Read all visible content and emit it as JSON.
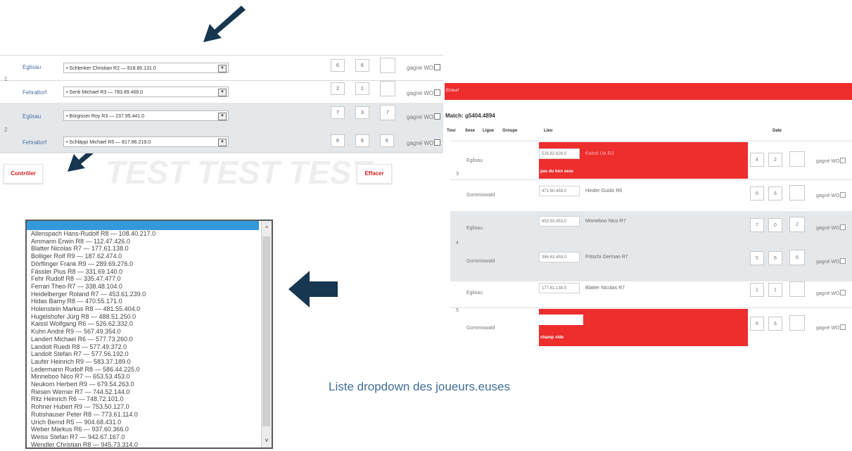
{
  "left_form": {
    "rows": [
      {
        "num": "1",
        "club": "Eglisau",
        "player": "• Schlenker Christian R2 — 818.80.131.0",
        "scores": [
          "6",
          "6",
          ""
        ],
        "wo_label": "gagné WO"
      },
      {
        "num": "",
        "club": "Fehraltorf",
        "player": "• Senti Michael R3 — 783.89.468.0",
        "scores": [
          "2",
          "1",
          ""
        ],
        "wo_label": "gagné WO"
      },
      {
        "num": "2",
        "club": "Eglisau",
        "player": "• Bürgisser Roy R3 — 237.95.441.0",
        "scores": [
          "7",
          "3",
          "7"
        ],
        "wo_label": "gagné WO"
      },
      {
        "num": "",
        "club": "Fehraltorf",
        "player": "• Schläppi Michael R5 — 817.86.219.0",
        "scores": [
          "6",
          "6",
          "6"
        ],
        "wo_label": "gagné WO"
      }
    ],
    "check_button": "Contrôler",
    "clear_button": "Effacer",
    "watermark": "TEST"
  },
  "right_form": {
    "error_banner": "Erreur!",
    "match_label": "Match:",
    "match_id": "g5404.4894",
    "headers": [
      "Tour",
      "Sexe",
      "Ligue",
      "Groupe",
      "Lieu",
      "Date"
    ],
    "rows": [
      {
        "num": "3",
        "club": "Eglisau",
        "license": "526.62.626.0",
        "player": "Kaissl Ua R3",
        "error": "pas du bon sexe",
        "scores": [
          "4",
          "2",
          ""
        ],
        "wo_label": "gagné WO"
      },
      {
        "num": "",
        "club": "Gommiswald",
        "license": "471.60.459.0",
        "player": "Hinder Guido R6",
        "error": "",
        "scores": [
          "6",
          "6",
          ""
        ],
        "wo_label": "gagné WO"
      },
      {
        "num": "4",
        "club": "Eglisau",
        "license": "653.53.453.0",
        "player": "Minneboo Nico R7",
        "error": "",
        "scores": [
          "7",
          "0",
          "2"
        ],
        "wo_label": "gagné WO"
      },
      {
        "num": "",
        "club": "Gommiswald",
        "license": "366.63.459.0",
        "player": "Fritschi German R7",
        "error": "",
        "scores": [
          "5",
          "6",
          "6"
        ],
        "wo_label": "gagné WO"
      },
      {
        "num": "5",
        "club": "Eglisau",
        "license": "177.61.138.0",
        "player": "Blatter Nicolas R7",
        "error": "",
        "scores": [
          "1",
          "1",
          ""
        ],
        "wo_label": "gagné WO"
      },
      {
        "num": "",
        "club": "Gommiswald",
        "license": "",
        "player": "",
        "error": "champ vide",
        "scores": [
          "6",
          "6",
          ""
        ],
        "wo_label": "gagné WO"
      }
    ]
  },
  "dropdown_list": {
    "items": [
      "Allenspach Hans-Rudolf R8 — 108.40.217.0",
      "Ammann Erwin R8 — 112.47.426.0",
      "Blatter Nicolas R7 — 177.61.138.0",
      "Bolliger Rolf R9 — 187.62.474.0",
      "Dörflinger Frank R9 — 289.69.276.0",
      "Fässler Pius R8 — 331.69.140.0",
      "Fehr Rudolf R8 — 335.47.477.0",
      "Ferrari Theo R7 — 338.48.104.0",
      "Heidelberger Roland R7 — 453.61.239.0",
      "Hidas Barny R8 — 470.55.171.0",
      "Holenstein Markus R8 — 481.55.404.0",
      "Hugelshofer Jürg R8 — 488.51.250.0",
      "Kaissl Wolfgang R6 — 526.62.332.0",
      "Kuhn André R9 — 567.49.354.0",
      "Landert Michael R6 — 577.73.260.0",
      "Landolt Ruedi R8 — 577.49.372.0",
      "Landolt Stefan R7 — 577.56.192.0",
      "Laufer Heinrich R9 — 583.37.189.0",
      "Ledermann Rudolf R8 — 586.44.225.0",
      "Minneboo Nico R7 — 653.53.453.0",
      "Neukom Herbert R9 — 679.54.263.0",
      "Riesen Werner R7 — 744.52.144.0",
      "Ritz Heinrich R6 — 748.72.101.0",
      "Rohner Hubert R9 — 753.50.127.0",
      "Rutishauser Peter R8 — 773.61.114.0",
      "Urich Bernd R5 — 904.68.431.0",
      "Weber Markus R6 — 937.60.366.0",
      "Weiss Stefan R7 — 942.67.167.0",
      "Wendler Christian R8 — 945.73.314.0"
    ],
    "up_arrow": "^",
    "down_arrow": "v"
  },
  "caption": "Liste dropdown des joueurs.euses",
  "colors": {
    "arrow": "#17364f",
    "error": "#ee2d2d",
    "link": "#4a6fa5",
    "button_text": "#d02020",
    "list_highlight": "#3399dd",
    "shaded_row": "#e4e8ea"
  }
}
